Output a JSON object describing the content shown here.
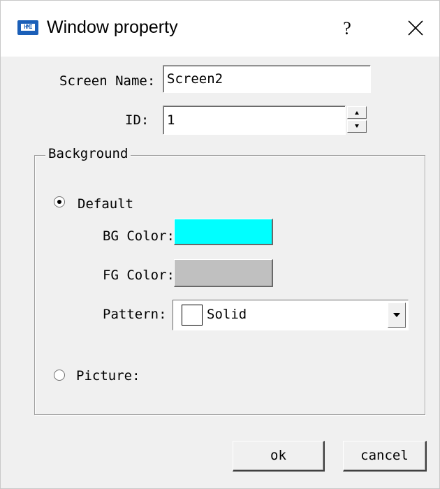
{
  "window": {
    "title": "Window property",
    "help_label": "?",
    "app_icon_text": "HMI"
  },
  "form": {
    "screen_name_label": "Screen Name:",
    "screen_name_value": "Screen2",
    "id_label": "ID:",
    "id_value": "1"
  },
  "background": {
    "group_label": "Background",
    "default_option": {
      "label": "Default",
      "selected": true
    },
    "bg_color_label": "BG Color:",
    "bg_color": "#00ffff",
    "fg_color_label": "FG Color:",
    "fg_color": "#c0c0c0",
    "pattern_label": "Pattern:",
    "pattern_value": "Solid",
    "picture_option": {
      "label": "Picture:",
      "selected": false
    }
  },
  "buttons": {
    "ok_label": "ok",
    "cancel_label": "cancel"
  },
  "icons": {
    "app": "hmi-app-icon",
    "close": "close-icon",
    "spin_up": "arrow-up-icon",
    "spin_down": "arrow-down-icon",
    "dropdown": "chevron-down-icon"
  }
}
